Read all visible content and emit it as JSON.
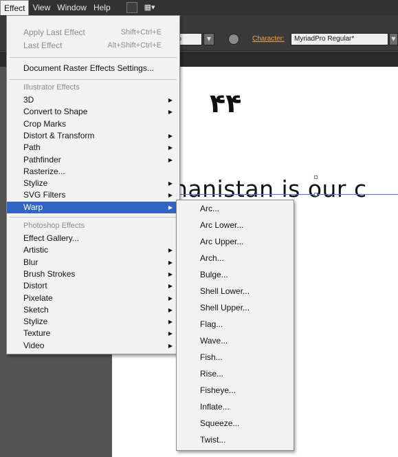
{
  "menubar": {
    "items": [
      "Effect",
      "View",
      "Window",
      "Help"
    ],
    "layout_glyph": "▦▾"
  },
  "controlbar": {
    "percent_suffix": "%",
    "character_label": "Character:",
    "font_value": "MyriadPro Regular*"
  },
  "canvas": {
    "arabic_text": "۴۴",
    "body_text": "hanistan is our c"
  },
  "effect_menu": {
    "apply_last": {
      "label": "Apply Last Effect",
      "shortcut": "Shift+Ctrl+E"
    },
    "last_effect": {
      "label": "Last Effect",
      "shortcut": "Alt+Shift+Ctrl+E"
    },
    "raster_settings": "Document Raster Effects Settings...",
    "illustrator_header": "Illustrator Effects",
    "illustrator_items": [
      {
        "label": "3D",
        "submenu": true
      },
      {
        "label": "Convert to Shape",
        "submenu": true
      },
      {
        "label": "Crop Marks",
        "submenu": false
      },
      {
        "label": "Distort & Transform",
        "submenu": true
      },
      {
        "label": "Path",
        "submenu": true
      },
      {
        "label": "Pathfinder",
        "submenu": true
      },
      {
        "label": "Rasterize...",
        "submenu": false
      },
      {
        "label": "Stylize",
        "submenu": true
      },
      {
        "label": "SVG Filters",
        "submenu": true
      },
      {
        "label": "Warp",
        "submenu": true,
        "highlighted": true
      }
    ],
    "photoshop_header": "Photoshop Effects",
    "photoshop_items": [
      {
        "label": "Effect Gallery...",
        "submenu": false
      },
      {
        "label": "Artistic",
        "submenu": true
      },
      {
        "label": "Blur",
        "submenu": true
      },
      {
        "label": "Brush Strokes",
        "submenu": true
      },
      {
        "label": "Distort",
        "submenu": true
      },
      {
        "label": "Pixelate",
        "submenu": true
      },
      {
        "label": "Sketch",
        "submenu": true
      },
      {
        "label": "Stylize",
        "submenu": true
      },
      {
        "label": "Texture",
        "submenu": true
      },
      {
        "label": "Video",
        "submenu": true
      }
    ],
    "submenu_arrow": "▶"
  },
  "warp_menu": {
    "items": [
      "Arc...",
      "Arc Lower...",
      "Arc Upper...",
      "Arch...",
      "Bulge...",
      "Shell Lower...",
      "Shell Upper...",
      "Flag...",
      "Wave...",
      "Fish...",
      "Rise...",
      "Fisheye...",
      "Inflate...",
      "Squeeze...",
      "Twist..."
    ]
  },
  "colors": {
    "highlight": "#3164c4",
    "menu_bg": "#f2f2f2",
    "app_dark": "#323232",
    "character_link": "#f0a44a"
  }
}
